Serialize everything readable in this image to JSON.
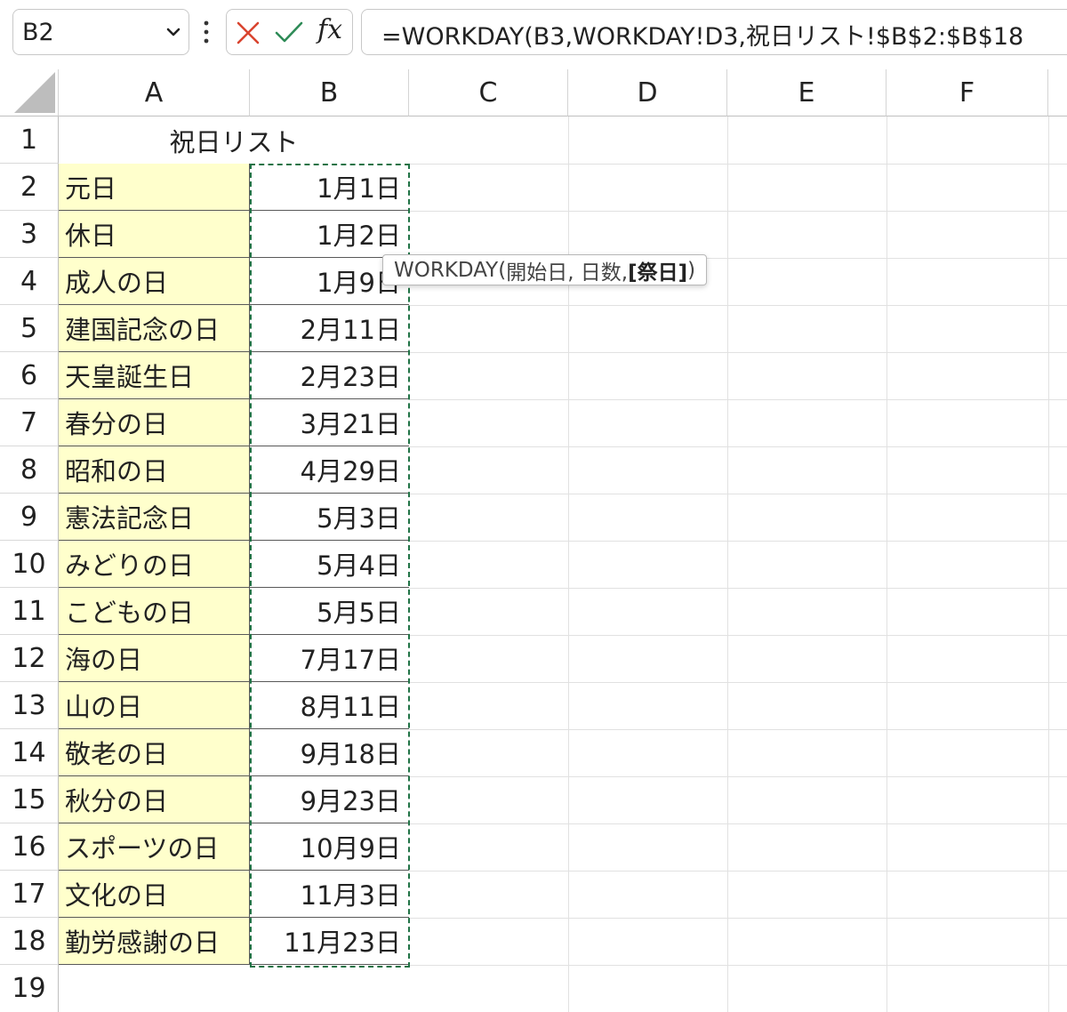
{
  "formula_bar": {
    "name_box": "B2",
    "formula": "=WORKDAY(B3,WORKDAY!D3,祝日リスト!$B$2:$B$18"
  },
  "columns": [
    "A",
    "B",
    "C",
    "D",
    "E",
    "F"
  ],
  "row_numbers": [
    "1",
    "2",
    "3",
    "4",
    "5",
    "6",
    "7",
    "8",
    "9",
    "10",
    "11",
    "12",
    "13",
    "14",
    "15",
    "16",
    "17",
    "18",
    "19"
  ],
  "sheet": {
    "title": "祝日リスト",
    "holidays": [
      {
        "name": "元日",
        "date": "1月1日"
      },
      {
        "name": "休日",
        "date": "1月2日"
      },
      {
        "name": "成人の日",
        "date": "1月9日"
      },
      {
        "name": "建国記念の日",
        "date": "2月11日"
      },
      {
        "name": "天皇誕生日",
        "date": "2月23日"
      },
      {
        "name": "春分の日",
        "date": "3月21日"
      },
      {
        "name": "昭和の日",
        "date": "4月29日"
      },
      {
        "name": "憲法記念日",
        "date": "5月3日"
      },
      {
        "name": "みどりの日",
        "date": "5月4日"
      },
      {
        "name": "こどもの日",
        "date": "5月5日"
      },
      {
        "name": "海の日",
        "date": "7月17日"
      },
      {
        "name": "山の日",
        "date": "8月11日"
      },
      {
        "name": "敬老の日",
        "date": "9月18日"
      },
      {
        "name": "秋分の日",
        "date": "9月23日"
      },
      {
        "name": "スポーツの日",
        "date": "10月9日"
      },
      {
        "name": "文化の日",
        "date": "11月3日"
      },
      {
        "name": "勤労感謝の日",
        "date": "11月23日"
      }
    ]
  },
  "tooltip": {
    "function_name": "WORKDAY(",
    "args": "開始日, 日数, ",
    "current_arg": "[祭日]",
    "close": ")"
  },
  "colors": {
    "label_fill": "#ffffcc",
    "marquee": "#217346",
    "cancel": "#d9442f",
    "enter": "#2e8b57"
  }
}
